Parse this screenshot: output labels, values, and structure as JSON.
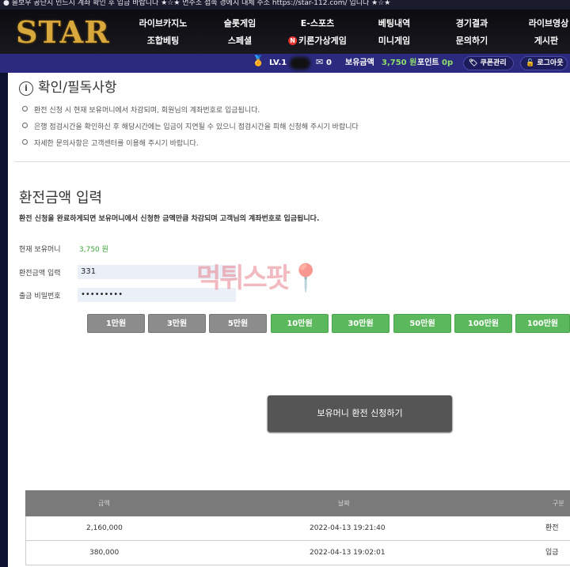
{
  "notice": "● 을보우 공단지 민드지 계좌 확인 후 입금 바랍니다 ★☆★ 먼주소 접속 경에지 대체 주소 https://star-112.com/ 입니다 ★☆★",
  "logo_text": "STAR",
  "nav": {
    "top": [
      "라이브카지노",
      "슬롯게임",
      "E-스포츠",
      "베팅내역",
      "경기결과",
      "라이브영상"
    ],
    "bottom": [
      "조합베팅",
      "스페셜",
      "키론가상게임",
      "미니게임",
      "문의하기",
      "게시판"
    ],
    "badge": "N"
  },
  "user_bar": {
    "level": "LV.1",
    "messages": "0",
    "balance_label": "보유금액",
    "balance_value": "3,750 원",
    "points_label": "포인트",
    "points_value": "0p",
    "coupon_label": "쿠폰관리",
    "logout_label": "로그아웃"
  },
  "info": {
    "title": "확인/필독사항",
    "bullets": [
      "환전 신청 시 현재 보유머니에서 차감되며, 회원님의 계좌번호로 입금됩니다.",
      "은행 점검시간을 확인하신 후 해당시간에는 입금이 지연될 수 있으니 점검시간을 피해 신청해 주시기 바랍니다",
      "자세한 문의사항은 고객센터를 이용해 주시기 바랍니다."
    ]
  },
  "exchange": {
    "title": "환전금액 입력",
    "description": "환전 신청을 완료하게되면 보유머니에서 신청한 금액만큼 차감되며 고객님의 계좌번호로 입금됩니다.",
    "balance_label": "현재 보유머니",
    "balance_value": "3,750 원",
    "amount_label": "환전금액 입력",
    "amount_value": "331",
    "password_label": "출금 비밀번호",
    "password_value": "•••••••••",
    "amount_buttons": [
      "1만원",
      "3만원",
      "5만원",
      "10만원",
      "30만원",
      "50만원",
      "100만원",
      "100만원"
    ],
    "submit_label": "보유머니 환전 신청하기"
  },
  "watermark": "먹튀스팟",
  "history": {
    "headers": [
      "금액",
      "날짜",
      "구분"
    ],
    "rows": [
      {
        "amount": "2,160,000",
        "date": "2022-04-13 19:21:40",
        "type": "환전"
      },
      {
        "amount": "380,000",
        "date": "2022-04-13 19:02:01",
        "type": "입금"
      }
    ]
  },
  "colors": {
    "header_bg": "#0c0c10",
    "user_bar_bg": "#2b2a7e",
    "accent_green": "#5cb85c",
    "button_gray": "#8c8c8c",
    "submit_bg": "#555555",
    "logo_gold": "#d8a83c"
  }
}
